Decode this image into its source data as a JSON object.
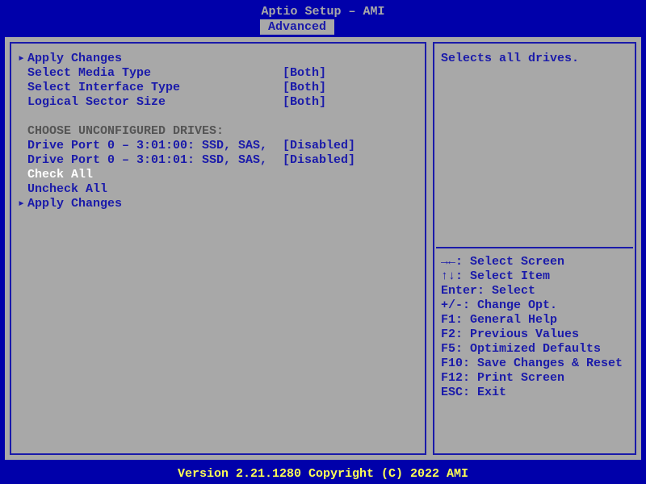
{
  "header": {
    "title": "Aptio Setup – AMI",
    "tab": "Advanced"
  },
  "menu": {
    "items": [
      {
        "arrow": "▸",
        "label": "Apply Changes",
        "value": "",
        "style": "link"
      },
      {
        "arrow": "",
        "label": "Select Media Type",
        "value": "[Both]",
        "style": "link"
      },
      {
        "arrow": "",
        "label": "Select Interface Type",
        "value": "[Both]",
        "style": "link"
      },
      {
        "arrow": "",
        "label": "Logical Sector Size",
        "value": "[Both]",
        "style": "link"
      },
      {
        "arrow": "",
        "label": "",
        "value": "",
        "style": "plain"
      },
      {
        "arrow": "",
        "label": "CHOOSE UNCONFIGURED DRIVES:",
        "value": "",
        "style": "header-grey"
      },
      {
        "arrow": "",
        "label": "Drive Port 0 – 3:01:00: SSD, SAS,",
        "value": "[Disabled]",
        "style": "link"
      },
      {
        "arrow": "",
        "label": "Drive Port 0 – 3:01:01: SSD, SAS,",
        "value": "[Disabled]",
        "style": "link"
      },
      {
        "arrow": "",
        "label": "Check All",
        "value": "",
        "style": "selected"
      },
      {
        "arrow": "",
        "label": "Uncheck All",
        "value": "",
        "style": "link"
      },
      {
        "arrow": "▸",
        "label": "Apply Changes",
        "value": "",
        "style": "link"
      }
    ]
  },
  "help": {
    "text": "Selects all drives.",
    "keys": [
      "→←: Select Screen",
      "↑↓: Select Item",
      "Enter: Select",
      "+/-: Change Opt.",
      "F1: General Help",
      "F2: Previous Values",
      "F5: Optimized Defaults",
      "F10: Save Changes & Reset",
      "F12: Print Screen",
      "ESC: Exit"
    ]
  },
  "footer": {
    "text": "Version 2.21.1280 Copyright (C) 2022 AMI"
  }
}
